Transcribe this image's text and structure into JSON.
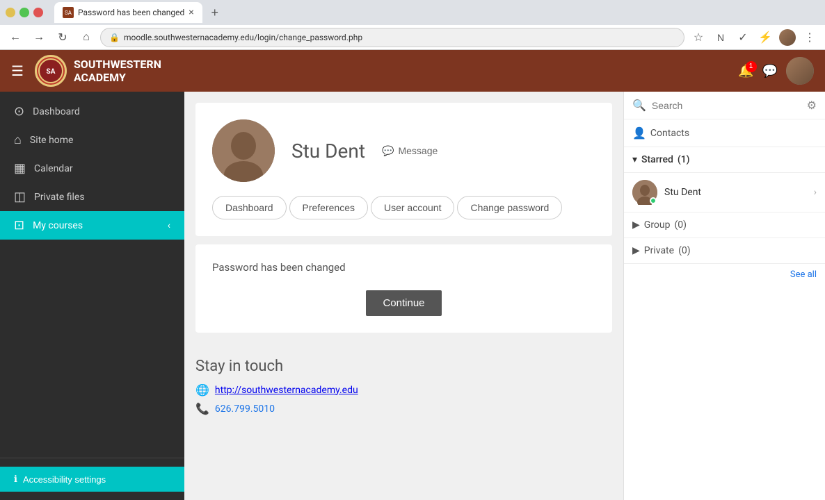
{
  "browser": {
    "tab_title": "Password has been changed",
    "url": "moodle.southwesternacademy.edu/login/change_password.php",
    "new_tab_label": "+"
  },
  "header": {
    "logo_text1": "SOUTHWESTERN",
    "logo_text2": "ACADEMY",
    "notification_count": "1"
  },
  "sidebar": {
    "items": [
      {
        "label": "Dashboard",
        "icon": "⊙"
      },
      {
        "label": "Site home",
        "icon": "⌂"
      },
      {
        "label": "Calendar",
        "icon": "▦"
      },
      {
        "label": "Private files",
        "icon": "◫"
      },
      {
        "label": "My courses",
        "icon": "⊡",
        "active": true
      }
    ],
    "collapse_icon": "‹",
    "accessibility_label": "Accessibility settings"
  },
  "profile": {
    "name": "Stu Dent",
    "message_btn": "Message",
    "tabs": [
      {
        "label": "Dashboard"
      },
      {
        "label": "Preferences"
      },
      {
        "label": "User account"
      },
      {
        "label": "Change password"
      }
    ]
  },
  "message_card": {
    "password_changed_text": "Password has been changed",
    "continue_btn": "Continue"
  },
  "stay_in_touch": {
    "title": "Stay in touch",
    "website": "http://southwesternacademy.edu",
    "phone": "626.799.5010"
  },
  "right_sidebar": {
    "search_placeholder": "Search",
    "contacts_label": "Contacts",
    "starred_section_label": "Starred",
    "starred_count": "(1)",
    "starred_user": "Stu Dent",
    "group_section_label": "Group",
    "group_count": "(0)",
    "private_section_label": "Private",
    "private_count": "(0)",
    "see_all_label": "See all"
  }
}
